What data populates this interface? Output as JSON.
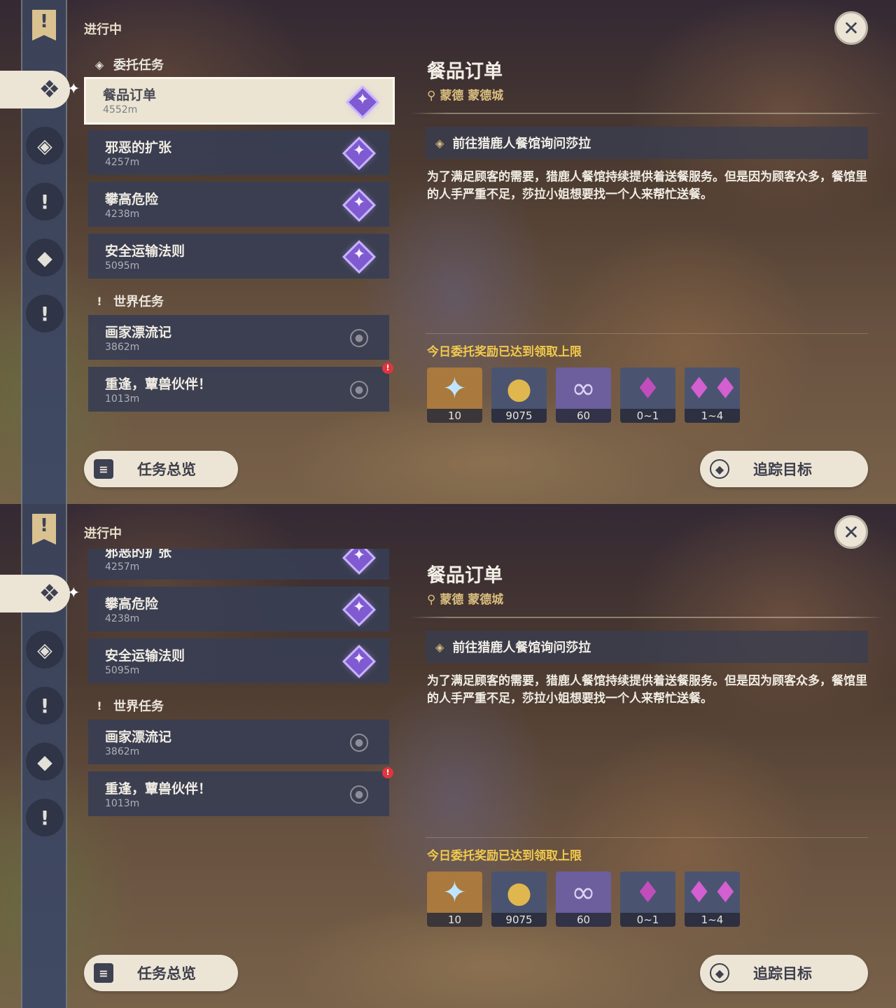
{
  "header": {
    "status": "进行中"
  },
  "sections": {
    "commission": "委托任务",
    "world": "世界任务"
  },
  "quests": [
    {
      "name": "餐品订单",
      "distance": "4552m"
    },
    {
      "name": "邪恶的扩张",
      "distance": "4257m"
    },
    {
      "name": "攀高危险",
      "distance": "4238m"
    },
    {
      "name": "安全运输法则",
      "distance": "5095m"
    },
    {
      "name": "画家漂流记",
      "distance": "3862m"
    },
    {
      "name": "重逢，蕈兽伙伴！",
      "distance": "1013m"
    }
  ],
  "buttons": {
    "overview": "任务总览",
    "track": "追踪目标"
  },
  "detail": {
    "title": "餐品订单",
    "location": "蒙德 蒙德城",
    "step": "前往猎鹿人餐馆询问莎拉",
    "description": "为了满足顾客的需要，猎鹿人餐馆持续提供着送餐服务。但是因为顾客众多，餐馆里的人手严重不足，莎拉小姐想要找一个人来帮忙送餐。",
    "limit_notice": "今日委托奖励已达到领取上限"
  },
  "rewards": [
    {
      "icon": "primogem-icon",
      "count": "10",
      "color": "#a9793d"
    },
    {
      "icon": "mora-icon",
      "count": "9075",
      "color": "#4a5470"
    },
    {
      "icon": "adventure-exp-icon",
      "count": "60",
      "color": "#6d5e9e"
    },
    {
      "icon": "crystal-icon",
      "count": "0~1",
      "color": "#4a5470"
    },
    {
      "icon": "crystal-cluster-icon",
      "count": "1~4",
      "color": "#4a5470"
    }
  ],
  "icons": {
    "rail": [
      "banner-icon",
      "commission-icon",
      "archon-quest-icon",
      "world-quest-icon",
      "story-quest-icon",
      "event-quest-icon"
    ],
    "close": "close-icon",
    "location": "location-pin-icon"
  }
}
